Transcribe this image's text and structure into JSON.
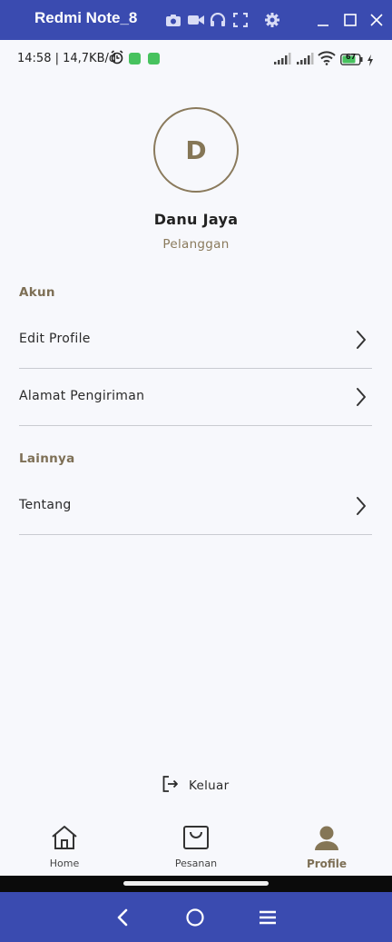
{
  "window": {
    "title": "Redmi Note_8",
    "toolbar_icons": [
      "camera-icon",
      "video-icon",
      "headset-icon",
      "fullscreen-icon",
      "settings-icon"
    ],
    "controls": [
      "minimize-icon",
      "maximize-icon",
      "close-icon"
    ]
  },
  "status_bar": {
    "text": "14:58 | 14,7KB/d",
    "battery": "67"
  },
  "profile": {
    "initial": "D",
    "name": "Danu Jaya",
    "role": "Pelanggan"
  },
  "sections": {
    "account_title": "Akun",
    "other_title": "Lainnya"
  },
  "menu": {
    "edit_profile": "Edit Profile",
    "shipping_address": "Alamat Pengiriman",
    "about": "Tentang"
  },
  "logout_label": "Keluar",
  "bottom_nav": {
    "home": "Home",
    "orders": "Pesanan",
    "profile": "Profile",
    "active": "profile"
  },
  "colors": {
    "accent": "#7d6f55",
    "emulator_bar": "#3a4bb0",
    "background": "#f7f8fc"
  }
}
